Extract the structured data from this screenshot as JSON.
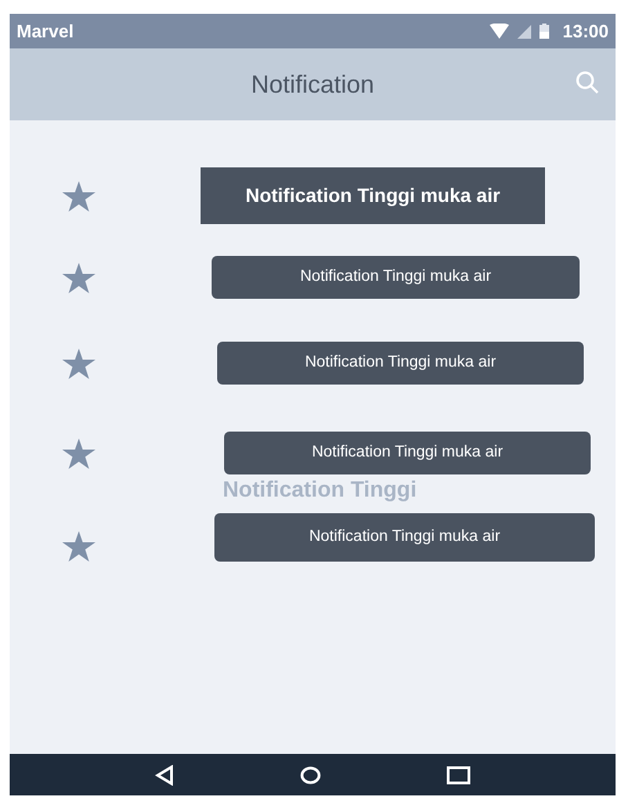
{
  "status_bar": {
    "carrier": "Marvel",
    "time": "13:00"
  },
  "app_bar": {
    "title": "Notification"
  },
  "notifications": [
    {
      "label": "Notification Tinggi muka air",
      "emphasized": true
    },
    {
      "label": "Notification Tinggi muka air",
      "emphasized": false
    },
    {
      "label": "Notification Tinggi muka air",
      "emphasized": false
    },
    {
      "label": "Notification Tinggi muka air",
      "emphasized": false
    },
    {
      "label": "Notification Tinggi muka air",
      "emphasized": false
    }
  ],
  "ghost_text": "Notification Tinggi"
}
